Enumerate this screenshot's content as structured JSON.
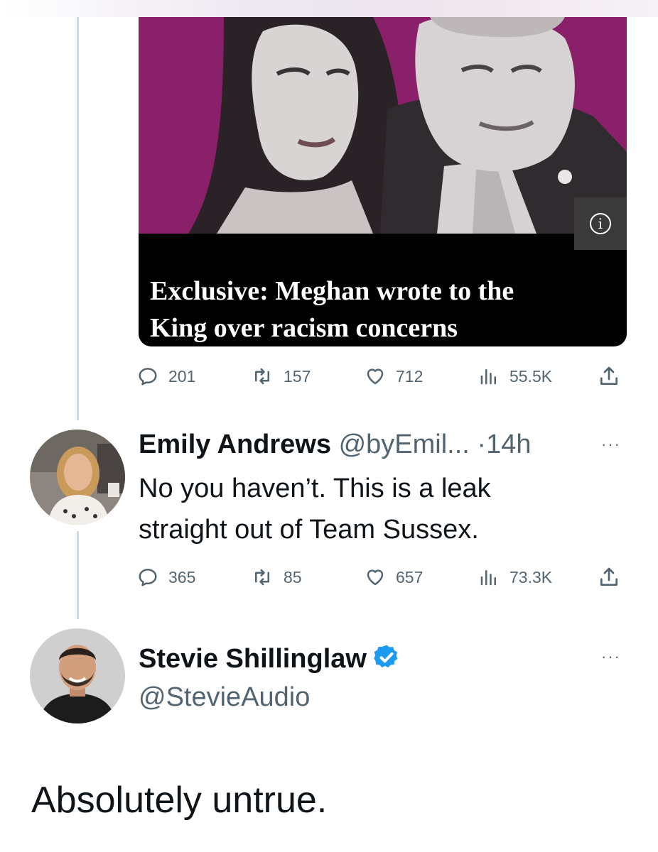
{
  "card": {
    "headline_line1": "Exclusive: Meghan wrote to the",
    "headline_line2": "King over racism concerns",
    "info_glyph": "i"
  },
  "first_tweet_actions": {
    "replies": "201",
    "retweets": "157",
    "likes": "712",
    "views": "55.5K"
  },
  "reply": {
    "name": "Emily Andrews",
    "handle": "@byEmil...",
    "separator": "·",
    "time": "14h",
    "more": "···",
    "text_line1": "No you haven’t. This is a leak",
    "text_line2": "straight out of Team Sussex.",
    "actions": {
      "replies": "365",
      "retweets": "85",
      "likes": "657",
      "views": "73.3K"
    }
  },
  "main_tweet": {
    "name": "Stevie Shillinglaw",
    "handle": "@StevieAudio",
    "more": "···",
    "text": "Absolutely untrue."
  },
  "colors": {
    "card_background": "#8a1f6a",
    "verified": "#1d9bf0",
    "secondary_text": "#536471",
    "thread_line": "#cfd9de"
  },
  "icons": [
    "reply-icon",
    "retweet-icon",
    "like-icon",
    "views-icon",
    "share-icon",
    "info-icon",
    "verified-badge-icon",
    "more-icon"
  ]
}
